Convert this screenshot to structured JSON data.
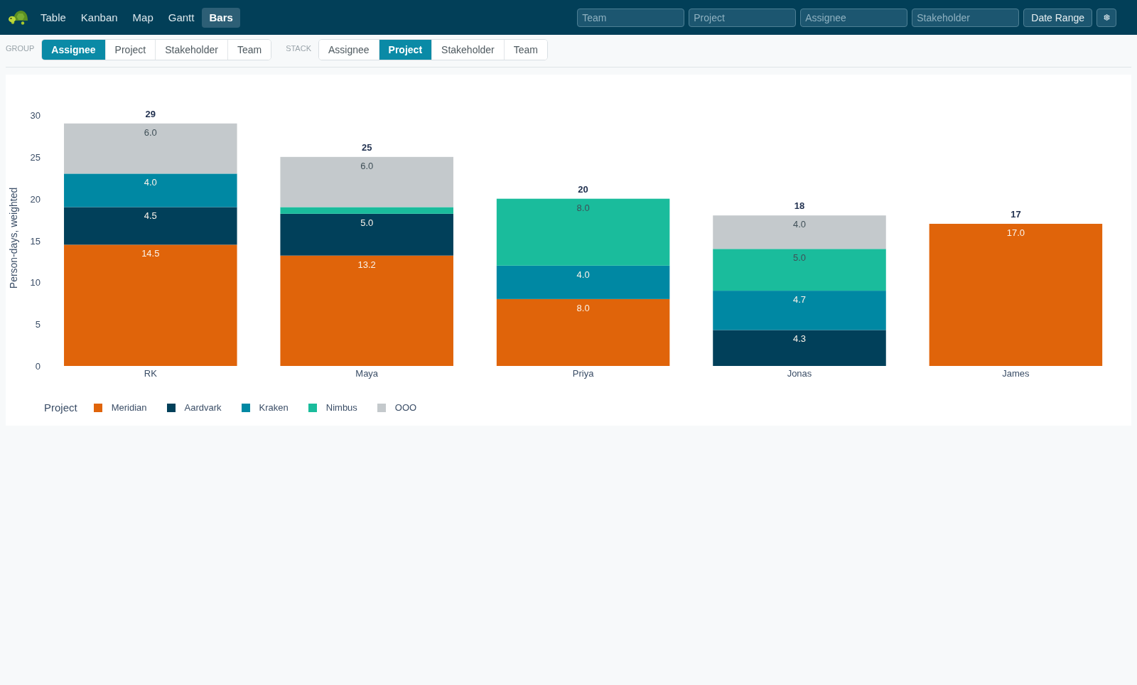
{
  "top_bar": {
    "tabs": [
      {
        "label": "Table",
        "selected": false
      },
      {
        "label": "Kanban",
        "selected": false
      },
      {
        "label": "Map",
        "selected": false
      },
      {
        "label": "Gantt",
        "selected": false
      },
      {
        "label": "Bars",
        "selected": true
      }
    ],
    "filters": [
      {
        "placeholder": "Team"
      },
      {
        "placeholder": "Project"
      },
      {
        "placeholder": "Assignee"
      },
      {
        "placeholder": "Stakeholder"
      }
    ],
    "date_range_button": "Date Range"
  },
  "controls": {
    "group": {
      "label": "GROUP",
      "options": [
        {
          "label": "Assignee",
          "selected": true
        },
        {
          "label": "Project",
          "selected": false
        },
        {
          "label": "Stakeholder",
          "selected": false
        },
        {
          "label": "Team",
          "selected": false
        }
      ]
    },
    "stack": {
      "label": "STACK",
      "options": [
        {
          "label": "Assignee",
          "selected": false
        },
        {
          "label": "Project",
          "selected": true
        },
        {
          "label": "Stakeholder",
          "selected": false
        },
        {
          "label": "Team",
          "selected": false
        }
      ]
    }
  },
  "chart": {
    "chart_data": {
      "type": "bar",
      "ylabel": "Person-days, weighted",
      "categories": [
        "RK",
        "Maya",
        "Priya",
        "Jonas",
        "James"
      ],
      "series": [
        {
          "name": "Meridian",
          "color": "#e0640a",
          "values": [
            14.5,
            13.2,
            8.0,
            0,
            17.0
          ]
        },
        {
          "name": "Aardvark",
          "color": "#01405a",
          "values": [
            4.5,
            5.0,
            0,
            4.3,
            0
          ]
        },
        {
          "name": "Kraken",
          "color": "#0088a3",
          "values": [
            4.0,
            0,
            4.0,
            4.7,
            0
          ]
        },
        {
          "name": "Nimbus",
          "color": "#1abc9c",
          "values": [
            0,
            0.8,
            8.0,
            5.0,
            0
          ]
        },
        {
          "name": "OOO",
          "color": "#c4c9cc",
          "values": [
            6.0,
            6.0,
            0,
            4.0,
            0
          ]
        }
      ],
      "ylim": [
        0,
        30
      ],
      "yticks": [
        0,
        5,
        10,
        15,
        20,
        25,
        30
      ],
      "stacked": true,
      "orientation": "vertical",
      "value_labels": [
        [
          "14.5",
          "13.2",
          "8.0",
          null,
          "17.0"
        ],
        [
          "4.5",
          "5.0",
          null,
          "4.3",
          null
        ],
        [
          "4.0",
          null,
          "4.0",
          "4.7",
          null
        ],
        [
          null,
          null,
          "8.0",
          "5.0",
          null
        ],
        [
          "6.0",
          "6.0",
          null,
          "4.0",
          null
        ]
      ],
      "annotations": [
        {
          "x": "RK",
          "y": 29,
          "text": "29"
        },
        {
          "x": "Maya",
          "y": 25,
          "text": "25"
        },
        {
          "x": "Priya",
          "y": 20,
          "text": "20"
        },
        {
          "x": "Jonas",
          "y": 18,
          "text": "18"
        },
        {
          "x": "James",
          "y": 17,
          "text": "17"
        }
      ]
    },
    "legend_title": "Project"
  }
}
